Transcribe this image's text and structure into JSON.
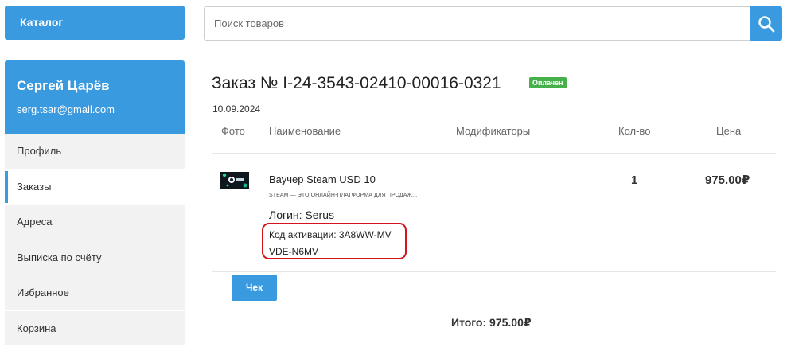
{
  "header": {
    "catalog_label": "Каталог",
    "search_placeholder": "Поиск товаров",
    "search_icon": "search-icon"
  },
  "user": {
    "name": "Сергей Царёв",
    "email": "serg.tsar@gmail.com"
  },
  "sidebar": {
    "items": [
      {
        "label": "Профиль"
      },
      {
        "label": "Заказы"
      },
      {
        "label": "Адреса"
      },
      {
        "label": "Выписка по счёту"
      },
      {
        "label": "Избранное"
      },
      {
        "label": "Корзина"
      }
    ],
    "active_label": "Заказы"
  },
  "order": {
    "title": "Заказ № I-24-3543-02410-00016-0321",
    "status": "Оплачен",
    "date": "10.09.2024",
    "columns": {
      "photo": "Фото",
      "name": "Наименование",
      "modifiers": "Модификаторы",
      "qty": "Кол-во",
      "price": "Цена"
    },
    "item": {
      "name": "Ваучер Steam USD 10",
      "description": "STEAM — ЭТО ОНЛАЙН-ПЛАТФОРМА ДЛЯ ПРОДАЖ...",
      "login": "Логин: Serus",
      "activation_code": "Код активации: 3A8WW-MVVDE-N6MV",
      "quantity": "1",
      "price": "975.00₽"
    },
    "check_label": "Чек",
    "total": "Итого: 975.00₽"
  },
  "colors": {
    "accent": "#3a9ae0",
    "status_green": "#46b04a",
    "highlight_red": "#d4141b",
    "sidebar_bg": "#f2f2f2"
  }
}
